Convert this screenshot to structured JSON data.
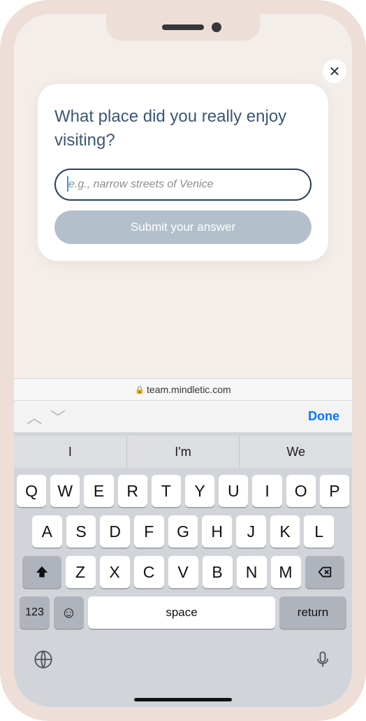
{
  "close_label": "✕",
  "card": {
    "title": "What place did you really enjoy visiting?",
    "placeholder": "e.g., narrow streets of Venice",
    "submit": "Submit your answer"
  },
  "address_bar": {
    "domain": "team.mindletic.com"
  },
  "accessory": {
    "done": "Done"
  },
  "suggestions": [
    "I",
    "I'm",
    "We"
  ],
  "keyboard": {
    "row1": [
      "Q",
      "W",
      "E",
      "R",
      "T",
      "Y",
      "U",
      "I",
      "O",
      "P"
    ],
    "row2": [
      "A",
      "S",
      "D",
      "F",
      "G",
      "H",
      "J",
      "K",
      "L"
    ],
    "row3": [
      "Z",
      "X",
      "C",
      "V",
      "B",
      "N",
      "M"
    ],
    "numkey": "123",
    "space": "space",
    "return": "return"
  }
}
